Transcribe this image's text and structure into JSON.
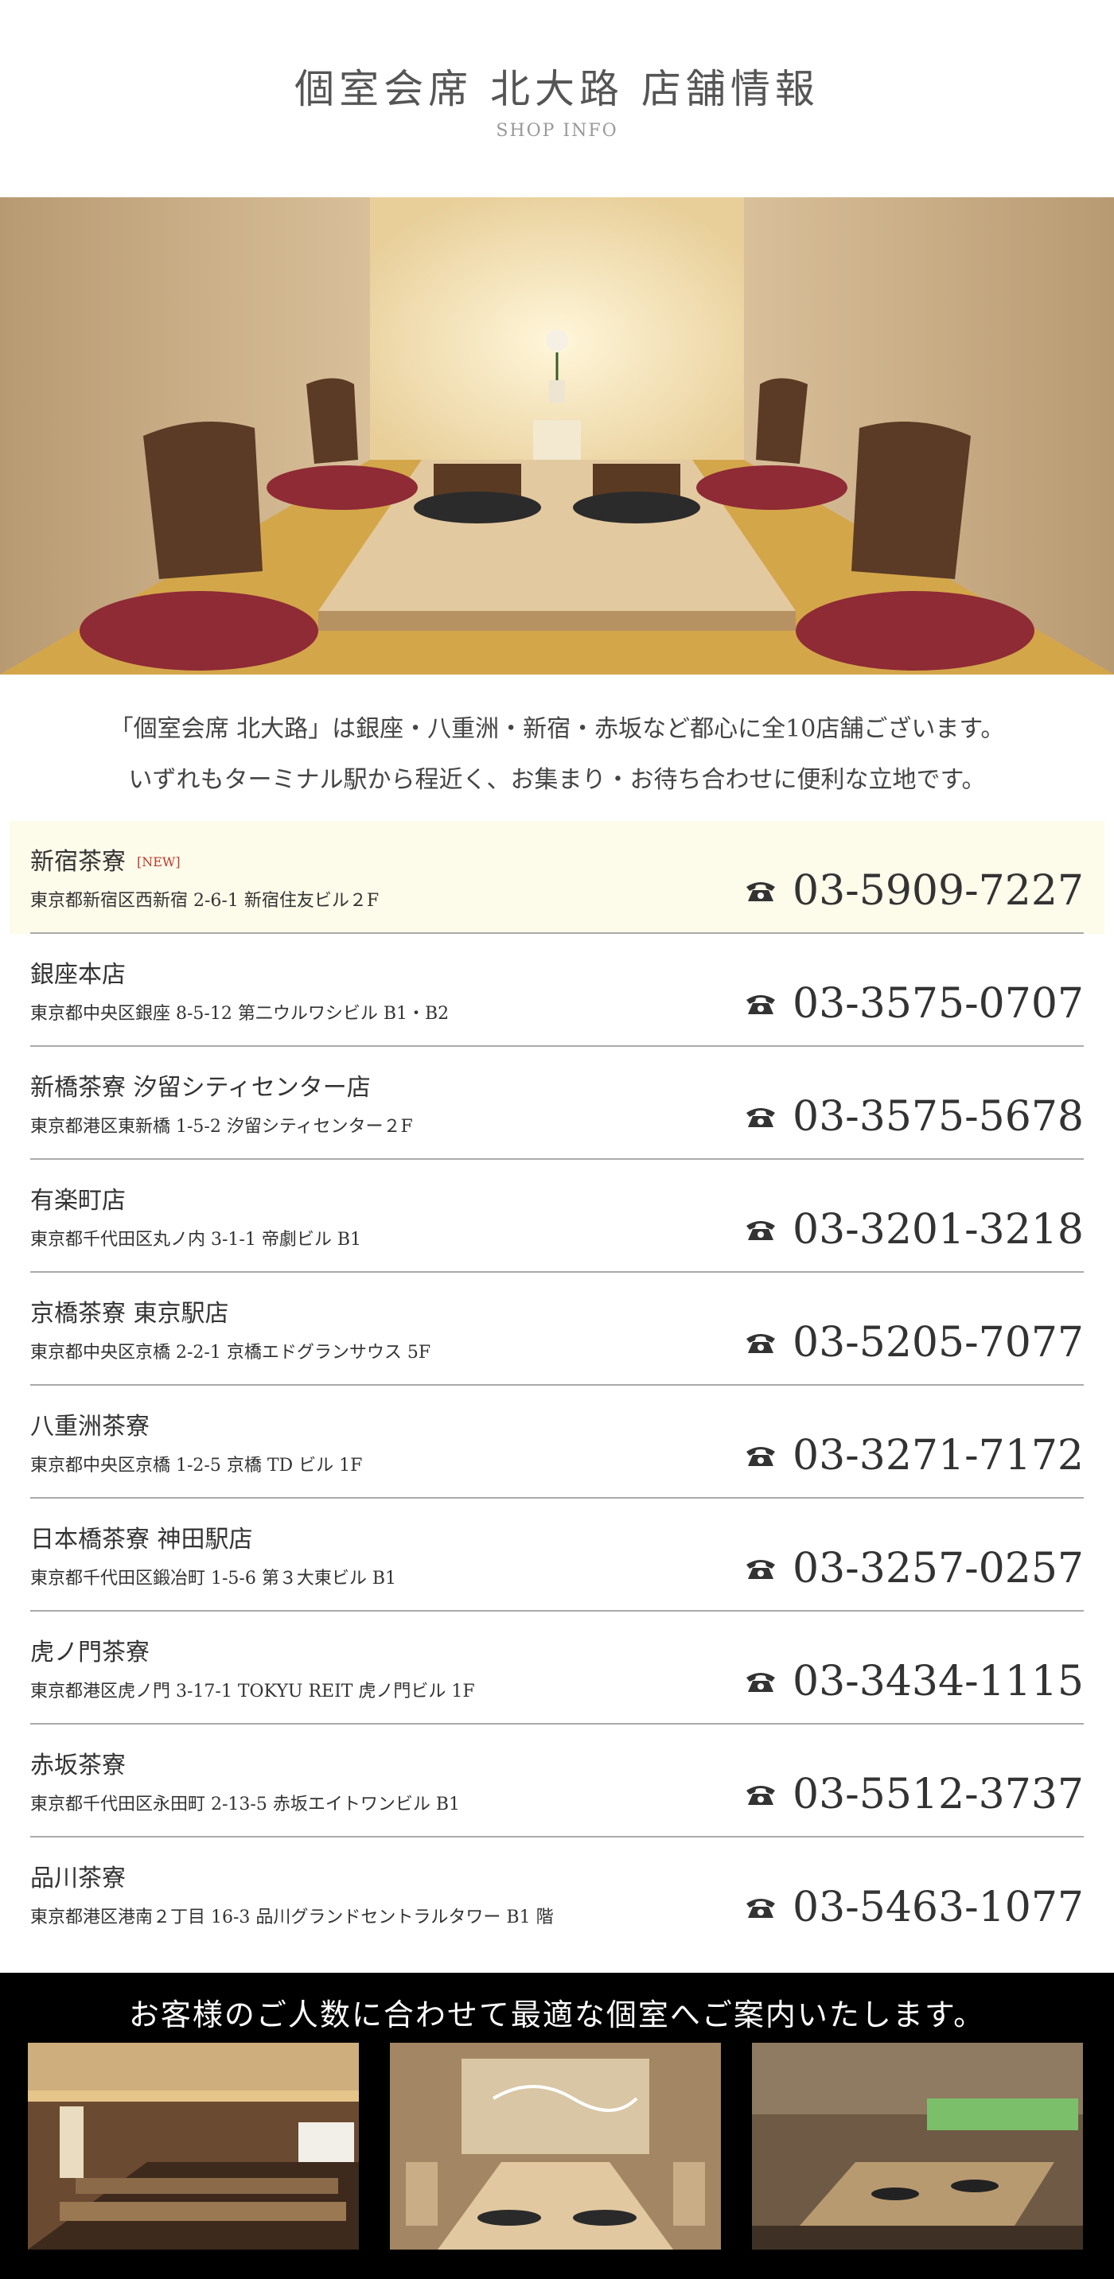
{
  "header": {
    "title": "個室会席 北大路 店舗情報",
    "subtitle": "SHOP INFO"
  },
  "intro": {
    "line1": "「個室会席 北大路」は銀座・八重洲・新宿・赤坂など都心に全10店舗ございます。",
    "line2": "いずれもターミナル駅から程近く、お集まり・お待ち合わせに便利な立地です。"
  },
  "shops": [
    {
      "name": "新宿茶寮",
      "badge": "[NEW]",
      "address": "東京都新宿区西新宿 2-6-1 新宿住友ビル２F",
      "tel": "03-5909-7227"
    },
    {
      "name": "銀座本店",
      "address": "東京都中央区銀座 8-5-12 第二ウルワシビル B1・B2",
      "tel": "03-3575-0707"
    },
    {
      "name": "新橋茶寮 汐留シティセンター店",
      "address": "東京都港区東新橋 1-5-2 汐留シティセンター２F",
      "tel": "03-3575-5678"
    },
    {
      "name": "有楽町店",
      "address": "東京都千代田区丸ノ内 3-1-1 帝劇ビル B1",
      "tel": "03-3201-3218"
    },
    {
      "name": "京橋茶寮 東京駅店",
      "address": "東京都中央区京橋 2-2-1 京橋エドグランサウス 5F",
      "tel": "03-5205-7077"
    },
    {
      "name": "八重洲茶寮",
      "address": "東京都中央区京橋 1-2-5 京橋 TD ビル 1F",
      "tel": "03-3271-7172"
    },
    {
      "name": "日本橋茶寮 神田駅店",
      "address": "東京都千代田区鍛冶町 1-5-6 第３大東ビル B1",
      "tel": "03-3257-0257"
    },
    {
      "name": "虎ノ門茶寮",
      "address": "東京都港区虎ノ門 3-17-1 TOKYU REIT 虎ノ門ビル 1F",
      "tel": "03-3434-1115"
    },
    {
      "name": "赤坂茶寮",
      "address": "東京都千代田区永田町 2-13-5 赤坂エイトワンビル B1",
      "tel": "03-5512-3737"
    },
    {
      "name": "品川茶寮",
      "address": "東京都港区港南２丁目 16-3 品川グランドセントラルタワー B1 階",
      "tel": "03-5463-1077"
    }
  ],
  "footer": {
    "title": "お客様のご人数に合わせて最適な個室へご案内いたします。"
  },
  "icons": {
    "tel": "phone-icon"
  },
  "colors": {
    "highlight_bg": "#fdfbea",
    "new_badge": "#c0392b",
    "footer_bg": "#000000"
  }
}
